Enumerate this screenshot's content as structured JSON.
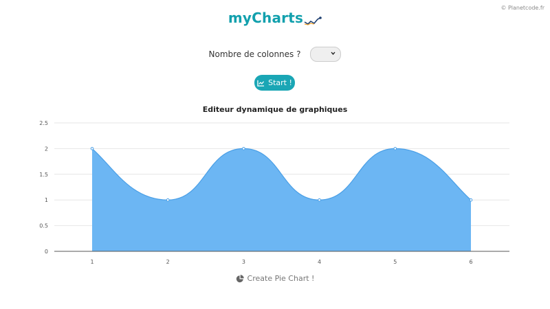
{
  "copyright": "© Planetcode.fr",
  "logo": {
    "text": "myCharts"
  },
  "form": {
    "columns_label": "Nombre de colonnes ?",
    "columns_value": ""
  },
  "start_button": {
    "label": "Start !",
    "icon": "chart-icon"
  },
  "pie_button": {
    "label": "Create Pie Chart !",
    "icon": "pie-chart-icon"
  },
  "colors": {
    "accent": "#1aa6b5",
    "logo": "#12a0ad",
    "area_fill": "#6cb6f3",
    "area_line": "#4a9fe6"
  },
  "chart_data": {
    "type": "area",
    "title": "Editeur dynamique de graphiques",
    "x": [
      1,
      2,
      3,
      4,
      5,
      6
    ],
    "values": [
      2,
      1,
      2,
      1,
      2,
      1
    ],
    "ylim": [
      0,
      2.5
    ],
    "yticks": [
      0,
      0.5,
      1,
      1.5,
      2,
      2.5
    ],
    "ytick_labels": [
      "0",
      "0.5",
      "1",
      "1.5",
      "2",
      "2.5"
    ],
    "xlabel": "",
    "ylabel": "",
    "grid": true,
    "curve": "smooth"
  }
}
